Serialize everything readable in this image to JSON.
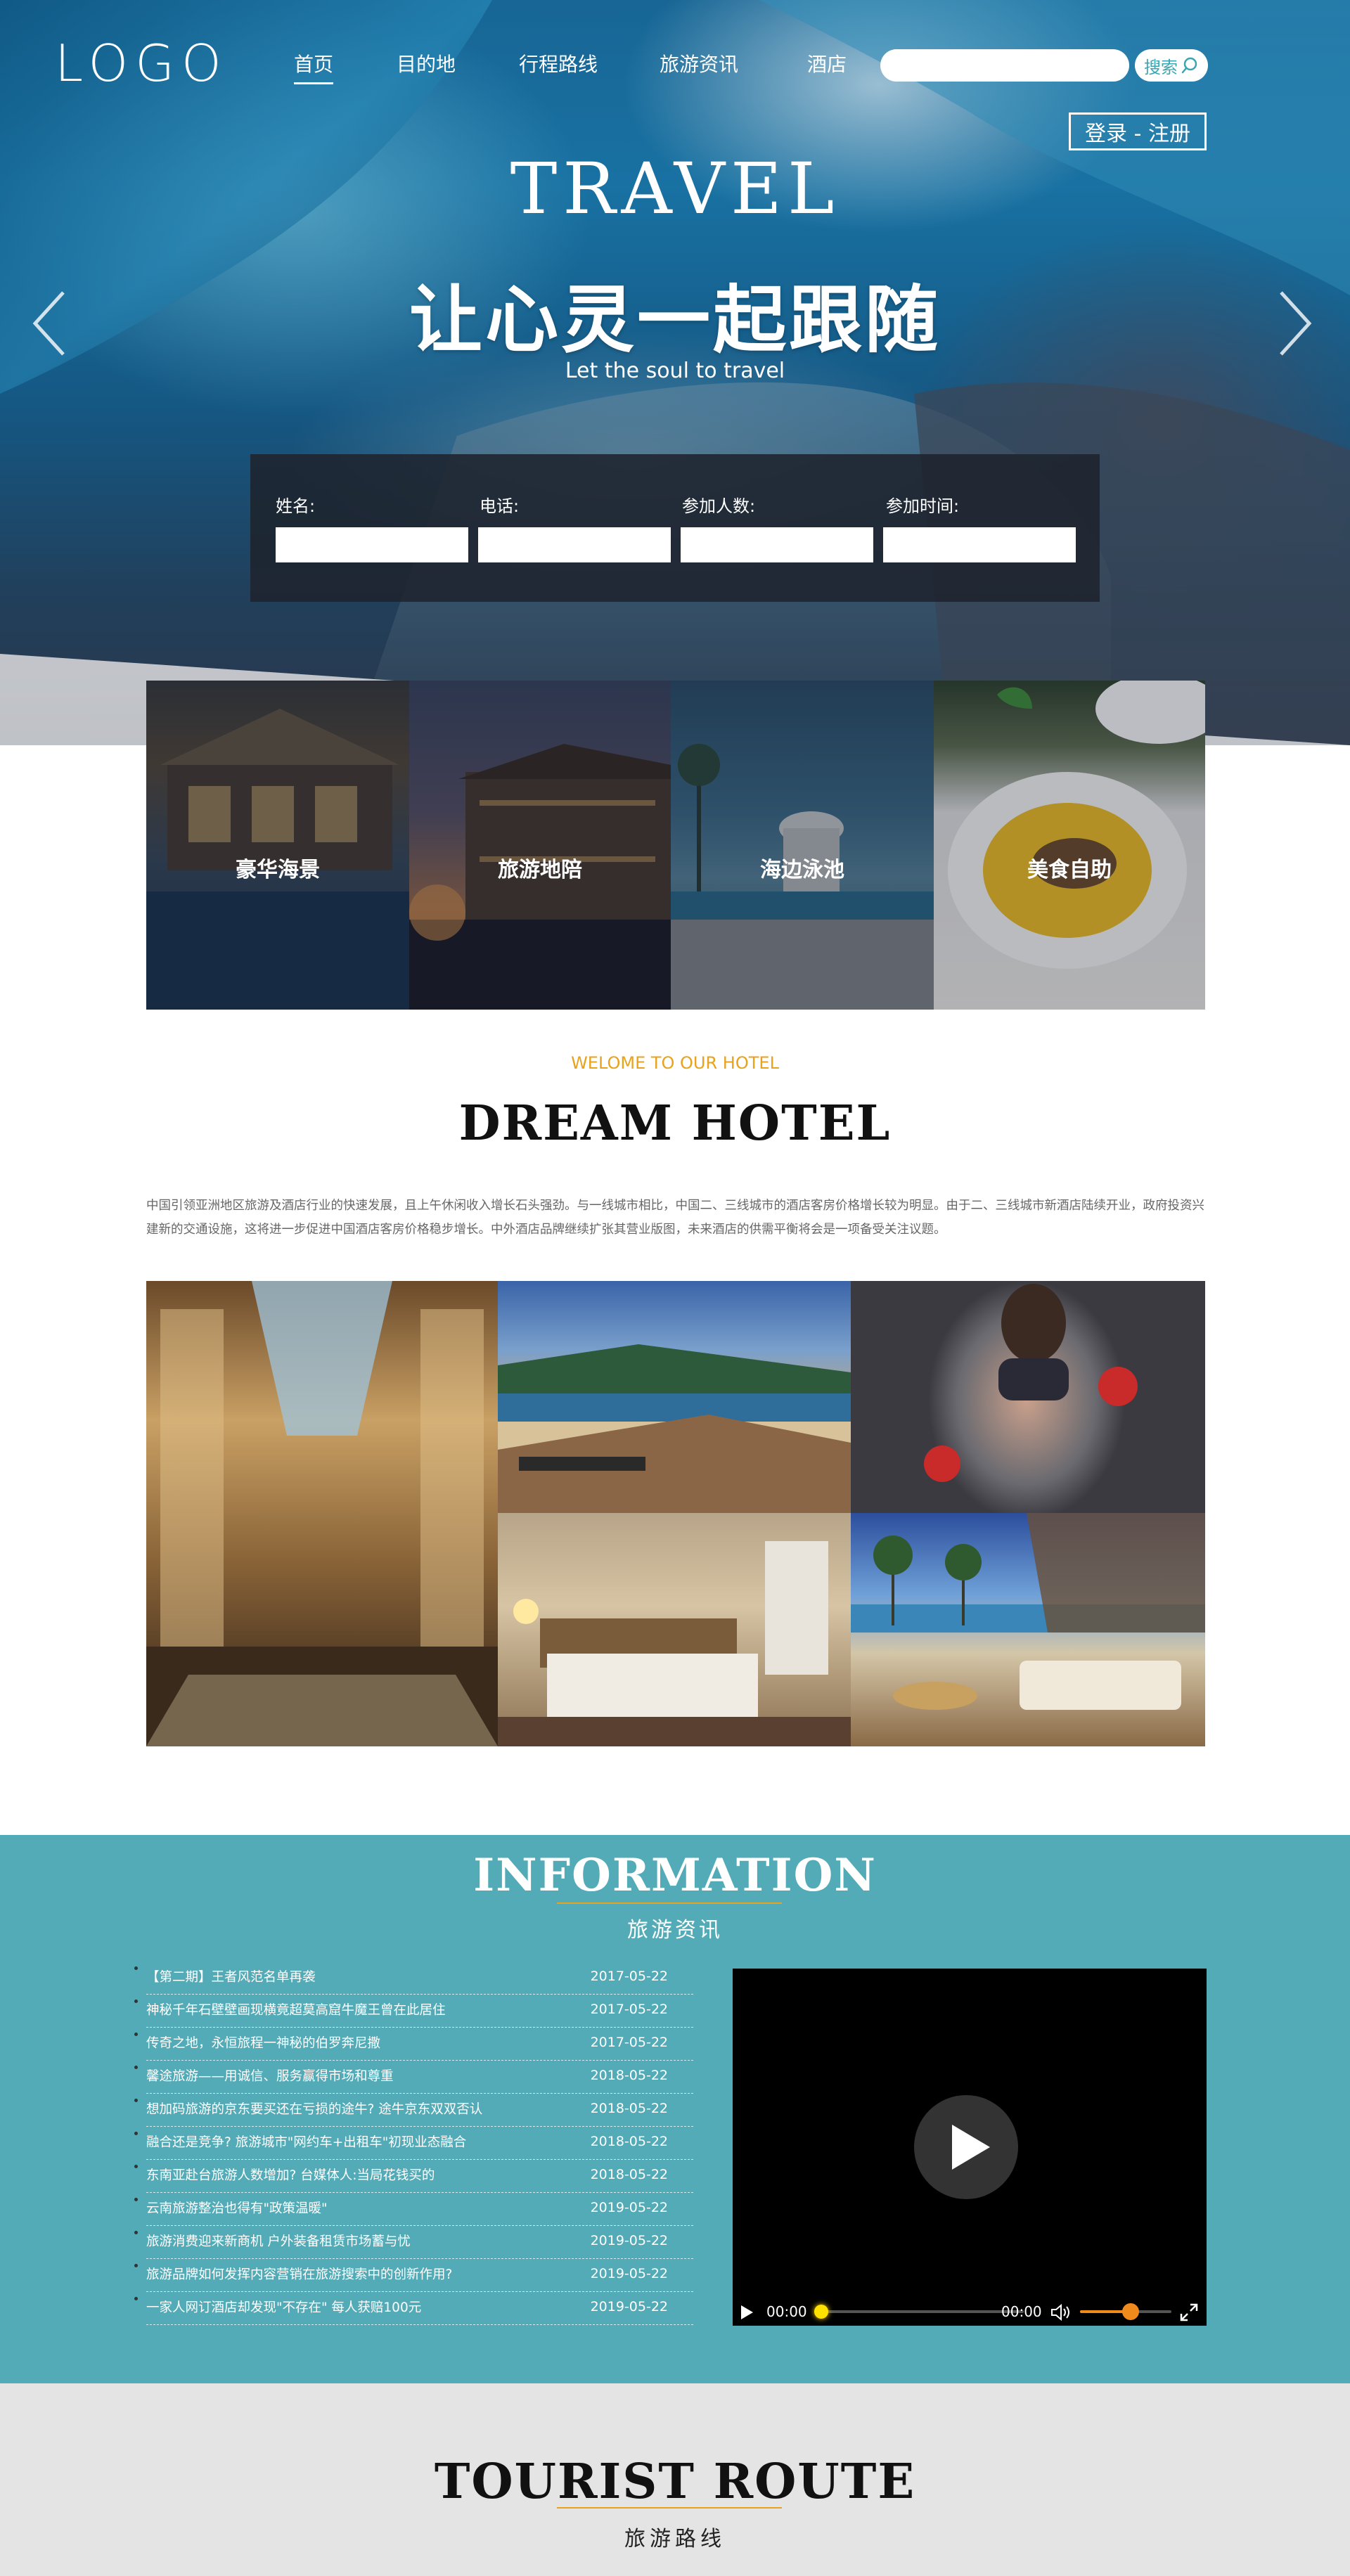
{
  "header": {
    "logo": "LOGO",
    "nav": [
      {
        "label": "首页",
        "active": true
      },
      {
        "label": "目的地"
      },
      {
        "label": "行程路线"
      },
      {
        "label": "旅游资讯"
      },
      {
        "label": "酒店"
      }
    ],
    "search_button": "搜索",
    "login_button": "登录 - 注册"
  },
  "hero": {
    "title": "TRAVEL",
    "subtitle": "让心灵一起跟随",
    "tagline": "Let the soul to travel"
  },
  "booking": {
    "fields": [
      {
        "label": "姓名:"
      },
      {
        "label": "电话:"
      },
      {
        "label": "参加人数:"
      },
      {
        "label": "参加时间:"
      }
    ]
  },
  "features": [
    {
      "label": "豪华海景"
    },
    {
      "label": "旅游地陪"
    },
    {
      "label": "海边泳池"
    },
    {
      "label": "美食自助"
    }
  ],
  "welcome": {
    "kicker": "WELOME TO OUR HOTEL",
    "title": "DREAM HOTEL",
    "intro": "中国引领亚洲地区旅游及酒店行业的快速发展，且上午休闲收入增长石头强劲。与一线城市相比，中国二、三线城市的酒店客房价格增长较为明显。由于二、三线城市新酒店陆续开业，政府投资兴建新的交通设施，这将进一步促进中国酒店客房价格稳步增长。中外酒店品牌继续扩张其营业版图，未来酒店的供需平衡将会是一项备受关注议题。"
  },
  "information": {
    "title": "INFORMATION",
    "subtitle": "旅游资讯",
    "news": [
      {
        "title": "【第二期】王者风范名单再袭",
        "date": "2017-05-22"
      },
      {
        "title": "神秘千年石壁壁画现横竟超莫高窟牛魔王曾在此居住",
        "date": "2017-05-22"
      },
      {
        "title": "传奇之地，永恒旅程一神秘的伯罗奔尼撒",
        "date": "2017-05-22"
      },
      {
        "title": "馨途旅游——用诚信、服务赢得市场和尊重",
        "date": "2018-05-22"
      },
      {
        "title": "想加码旅游的京东要买还在亏损的途牛? 途牛京东双双否认",
        "date": "2018-05-22"
      },
      {
        "title": "融合还是竞争? 旅游城市\"网约车+出租车\"初现业态融合",
        "date": "2018-05-22"
      },
      {
        "title": "东南亚赴台旅游人数增加? 台媒体人:当局花钱买的",
        "date": "2018-05-22"
      },
      {
        "title": "云南旅游整治也得有\"政策温暖\"",
        "date": "2019-05-22"
      },
      {
        "title": "旅游消费迎来新商机 户外装备租赁市场蓄与忧",
        "date": "2019-05-22"
      },
      {
        "title": "旅游品牌如何发挥内容营销在旅游搜索中的创新作用?",
        "date": "2019-05-22"
      },
      {
        "title": "一家人网订酒店却发现\"不存在\" 每人获赔100元",
        "date": "2019-05-22"
      }
    ],
    "video": {
      "current_time": "00:00",
      "duration": "00:00",
      "progress": 0.0,
      "volume": 0.55
    }
  },
  "route": {
    "title": "TOURIST ROUTE",
    "subtitle": "旅游路线"
  },
  "colors": {
    "accent_teal": "#52abb6",
    "accent_orange": "#e8a21c",
    "route_bg": "#e4e4e4"
  },
  "icons": {
    "search": "search-icon",
    "prev": "chevron-left-icon",
    "next": "chevron-right-icon",
    "play": "play-icon",
    "mute": "volume-icon",
    "fullscreen": "fullscreen-icon"
  }
}
